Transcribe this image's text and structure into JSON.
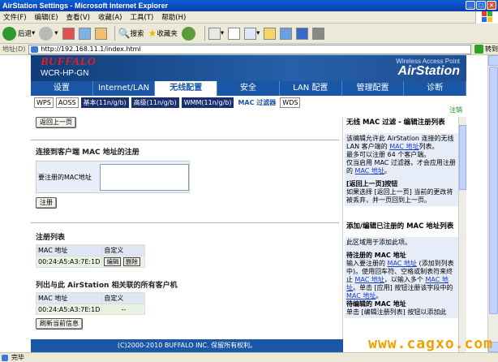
{
  "window": {
    "title": "AirStation Settings - Microsoft Internet Explorer"
  },
  "menubar": [
    "文件(F)",
    "编辑(E)",
    "查看(V)",
    "收藏(A)",
    "工具(T)",
    "帮助(H)"
  ],
  "toolbar": {
    "back": "后退",
    "search": "搜索",
    "favorites": "收藏夹"
  },
  "address": {
    "label": "地址(D)",
    "url": "http://192.168.11.1/index.html",
    "go": "转到"
  },
  "router": {
    "brand": "BUFFALO",
    "model": "WCR-HP-GN",
    "product_sub": "Wireless Access Point",
    "product": "AirStation",
    "main_tabs": [
      "设置",
      "Internet/LAN",
      "无线配置",
      "安全",
      "LAN 配置",
      "管理配置",
      "诊断"
    ],
    "active_tab": "无线配置",
    "sub_tabs": [
      "WPS",
      "AOSS",
      "基本(11n/g/b)",
      "高级(11n/g/b)",
      "WMM(11n/g/b)",
      "MAC 过滤器",
      "WDS"
    ],
    "logout": "注销",
    "back_button": "返回上一页",
    "section_connect_title": "连接到客户端  MAC 地址的注册",
    "register_label": "要注册的MAC地址",
    "register_button": "注册",
    "reg_list_title": "注册列表",
    "reg_list_headers": [
      "MAC 地址",
      "自定义"
    ],
    "reg_list_rows": [
      {
        "mac": "00:24:A5:A3:7E:1D",
        "edit": "编辑",
        "delete": "删除"
      }
    ],
    "associated_title": "列出与此  AirStation 相关联的所有客户机",
    "associated_headers": [
      "MAC 地址",
      "自定义"
    ],
    "associated_rows": [
      {
        "mac": "00:24:A5:A3:7E:1D",
        "custom": "--"
      }
    ],
    "refresh_button": "刷新当前信息",
    "footer": "(C)2000-2010 BUFFALO INC. 保留所有权利。"
  },
  "help": {
    "title": "无线 MAC 过滤 - 编辑注册列表",
    "p1": "该编辑允许此 AirStation 连接的无线 LAN 客户端的",
    "p1_link": "MAC 地址",
    "p1_end": "列表。",
    "p2": "最多可以注册 64 个客户端。",
    "p3a": "仅当启用 MAC 过滤器，才会应用注册的",
    "p3_link": "MAC 地址",
    "p3_end": "。",
    "back_heading": "[返回上一页]按钮",
    "back_text": "如果选择 [返回上一页] 当前的更改将被丢弃，并一页回到上一页。",
    "edit_title": "添加/编辑已注册的 MAC 地址列表",
    "edit_text": "此区域用于添加此项。",
    "pending_heading": "待注册的 MAC 地址",
    "pending_text_a": "输入要注册的",
    "pending_link": "MAC 地址",
    "pending_text_b": "(添加到列表中)。使用回车符、空格或制表符来终止",
    "pending_link2": "MAC 地址",
    "pending_text_c": "，以输入多个",
    "pending_link3": "MAC 地址",
    "pending_text_d": "。单击 [应用] 按钮注册该字段中的",
    "pending_link4": "MAC 地址",
    "pending_end": "。",
    "registered_heading": "待编辑的 MAC 地址",
    "registered_text": "单击 [编辑注册列表] 按钮以添加此"
  },
  "statusbar": {
    "text": "完毕"
  },
  "watermark": "www.cagxo.com"
}
